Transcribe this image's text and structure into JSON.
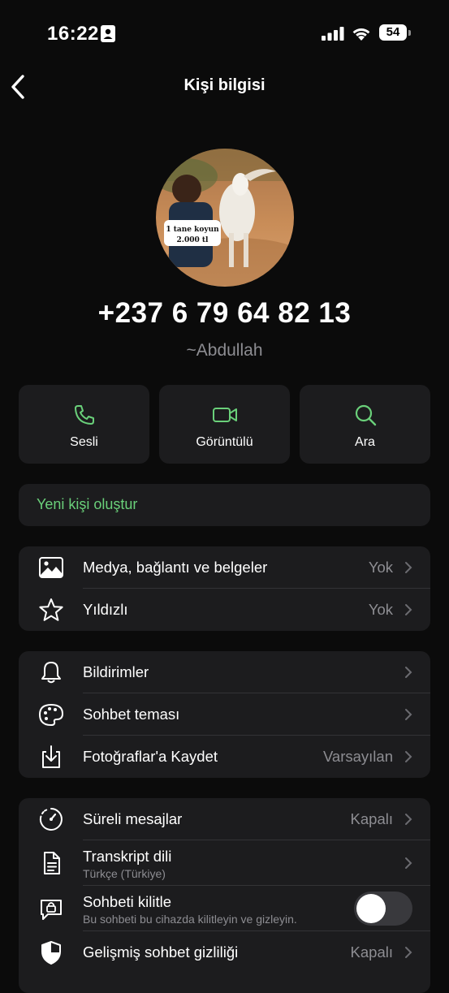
{
  "status_bar": {
    "time": "16:22",
    "battery": "54"
  },
  "nav": {
    "title": "Kişi bilgisi"
  },
  "contact": {
    "avatar_caption_line1": "1 tane koyun",
    "avatar_caption_line2": "2.000 tl",
    "phone": "+237 6 79 64 82 13",
    "username": "~Abdullah"
  },
  "actions": [
    {
      "label": "Sesli",
      "icon": "phone-icon"
    },
    {
      "label": "Görüntülü",
      "icon": "video-icon"
    },
    {
      "label": "Ara",
      "icon": "search-icon"
    }
  ],
  "new_contact": {
    "label": "Yeni kişi oluştur"
  },
  "group1": [
    {
      "label": "Medya, bağlantı ve belgeler",
      "value": "Yok",
      "icon": "image-icon"
    },
    {
      "label": "Yıldızlı",
      "value": "Yok",
      "icon": "star-icon"
    }
  ],
  "group2": [
    {
      "label": "Bildirimler",
      "value": "",
      "icon": "bell-icon"
    },
    {
      "label": "Sohbet teması",
      "value": "",
      "icon": "palette-icon"
    },
    {
      "label": "Fotoğraflar'a Kaydet",
      "value": "Varsayılan",
      "icon": "save-download-icon"
    }
  ],
  "group3": [
    {
      "label": "Süreli mesajlar",
      "value": "Kapalı",
      "icon": "timer-icon"
    },
    {
      "label": "Transkript dili",
      "sublabel": "Türkçe (Türkiye)",
      "icon": "document-icon"
    },
    {
      "label": "Sohbeti kilitle",
      "sublabel": "Bu sohbeti bu cihazda kilitleyin ve gizleyin.",
      "icon": "chat-lock-icon",
      "toggle_on": false
    },
    {
      "label": "Gelişmiş sohbet gizliliği",
      "value": "Kapalı",
      "icon": "shield-icon"
    }
  ],
  "colors": {
    "accent": "#6ad07a",
    "card": "#1c1c1e",
    "background": "#0b0b0b",
    "secondary_text": "#8d8d92"
  }
}
